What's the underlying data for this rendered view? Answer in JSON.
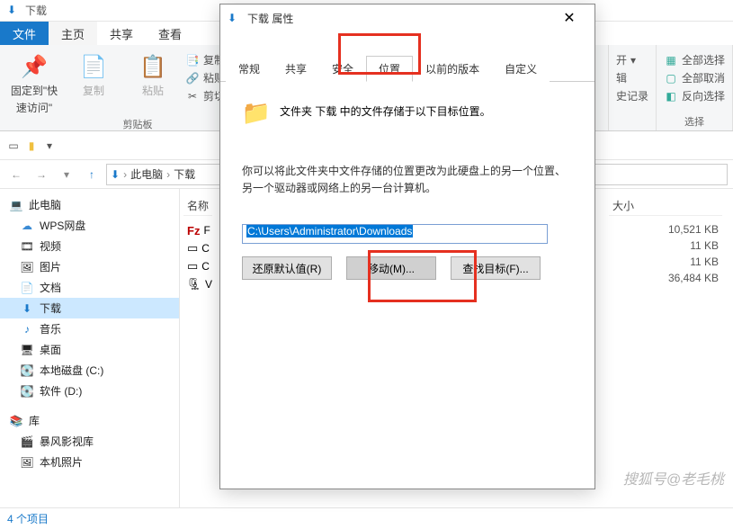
{
  "window": {
    "title": "下载"
  },
  "ribbon": {
    "tabs": {
      "file": "文件",
      "home": "主页",
      "share": "共享",
      "view": "查看"
    },
    "pin": {
      "label1": "固定到\"快",
      "label2": "速访问\""
    },
    "copy": "复制",
    "paste": "粘贴",
    "copypath": "复制路径",
    "pasteshortcut": "粘贴快捷方式",
    "cut": "剪切",
    "clipboard_label": "剪贴板",
    "open_partial": "开",
    "edit_partial": "辑",
    "history_partial": "史记录",
    "select_all": "全部选择",
    "select_none": "全部取消",
    "invert": "反向选择",
    "select_label": "选择"
  },
  "breadcrumb": {
    "pc": "此电脑",
    "dl": "下载"
  },
  "tree": {
    "pc": "此电脑",
    "wps": "WPS网盘",
    "video": "视频",
    "pictures": "图片",
    "documents": "文档",
    "downloads": "下载",
    "music": "音乐",
    "desktop": "桌面",
    "diskc": "本地磁盘 (C:)",
    "diskd": "软件 (D:)",
    "library": "库",
    "baofeng": "暴风影视库",
    "localpics": "本机照片"
  },
  "columns": {
    "name": "名称",
    "size": "大小"
  },
  "files": {
    "f1": "F",
    "f2": "C",
    "f3": "C",
    "f4": "V"
  },
  "sizes": {
    "s1": "10,521 KB",
    "s2": "11 KB",
    "s3": "11 KB",
    "s4": "36,484 KB"
  },
  "status": "4 个项目",
  "dialog": {
    "title": "下载 属性",
    "tabs": {
      "general": "常规",
      "share": "共享",
      "security": "安全",
      "location": "位置",
      "prev": "以前的版本",
      "custom": "自定义"
    },
    "line1": "文件夹 下载 中的文件存储于以下目标位置。",
    "line2": "你可以将此文件夹中文件存储的位置更改为此硬盘上的另一个位置、另一个驱动器或网络上的另一台计算机。",
    "path": "C:\\Users\\Administrator\\Downloads",
    "restore": "还原默认值(R)",
    "move": "移动(M)...",
    "find": "查找目标(F)..."
  },
  "watermark": "搜狐号@老毛桃"
}
